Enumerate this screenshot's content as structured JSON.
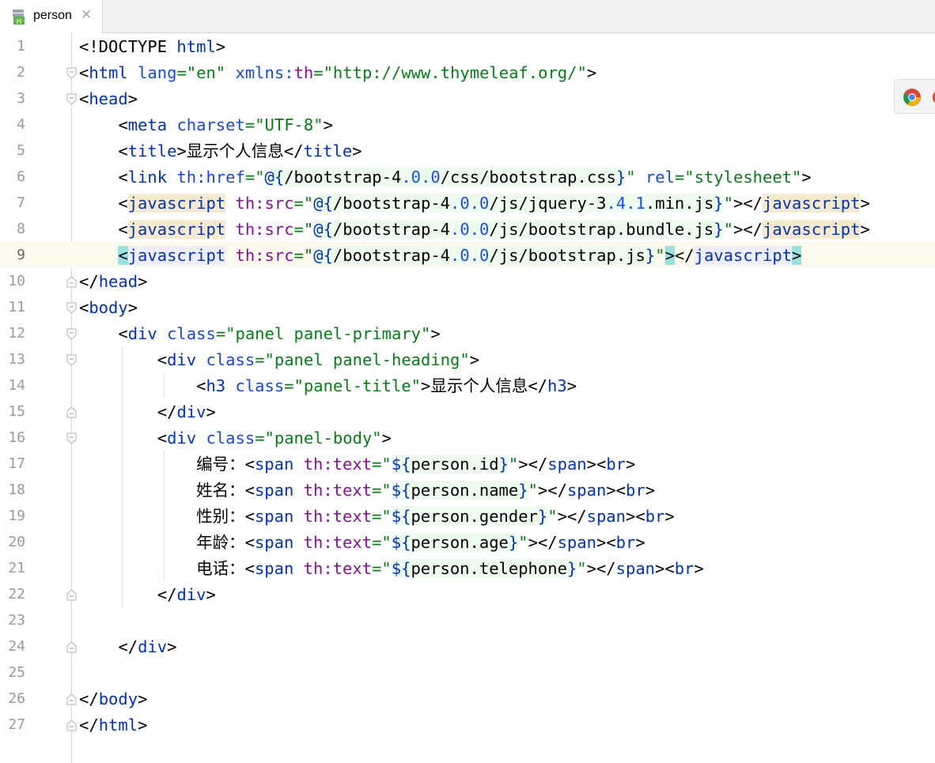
{
  "tab": {
    "label": "person",
    "close_glyph": "×",
    "icon": "html-file-icon"
  },
  "browser_popup": {
    "icons": [
      "chrome-icon",
      "browser-icon"
    ]
  },
  "line_numbers": [
    "1",
    "2",
    "3",
    "4",
    "5",
    "6",
    "7",
    "8",
    "9",
    "10",
    "11",
    "12",
    "13",
    "14",
    "15",
    "16",
    "17",
    "18",
    "19",
    "20",
    "21",
    "22",
    "23",
    "24",
    "25",
    "26",
    "27"
  ],
  "code": {
    "l1": {
      "doctype": "<!DOCTYPE ",
      "html": "html",
      "close": ">"
    },
    "l2": {
      "lt": "<",
      "tag": "html",
      "sp1": " ",
      "attr1": "lang",
      "eq1": "=",
      "val1": "\"en\"",
      "sp2": " ",
      "attr2": "xmlns:",
      "ns": "th",
      "eq2": "=",
      "val2": "\"http://www.thymeleaf.org/\"",
      "gt": ">"
    },
    "l3": {
      "lt": "<",
      "tag": "head",
      "gt": ">"
    },
    "l4": {
      "indent": "    ",
      "lt": "<",
      "tag": "meta",
      "sp": " ",
      "attr": "charset",
      "eq": "=",
      "val": "\"UTF-8\"",
      "gt": ">"
    },
    "l5": {
      "indent": "    ",
      "lt": "<",
      "tag": "title",
      "gt": ">",
      "text": "显示个人信息",
      "close_lt": "</",
      "close_tag": "title",
      "close_gt": ">"
    },
    "l6": {
      "indent": "    ",
      "lt": "<",
      "tag": "link",
      "sp": " ",
      "attr": "th:href",
      "eq": "=",
      "q1": "\"",
      "at": "@{",
      "p1": "/bootstrap-4",
      "n1": ".0.0",
      "p2": "/css/bootstrap.css",
      "endb": "}",
      "q2": "\"",
      "sp2": " ",
      "attr2": "rel",
      "eq2": "=",
      "val2": "\"stylesheet\"",
      "gt": ">"
    },
    "l7": {
      "indent": "    ",
      "lt": "<",
      "tag": "javascript",
      "sp": " ",
      "attr": "th:src",
      "eq": "=",
      "q1": "\"",
      "at": "@{",
      "p1": "/bootstrap-4",
      "n1": ".0.0",
      "p2": "/js/jquery-3",
      "n2": ".4.1",
      "p3": ".min.js",
      "endb": "}",
      "q2": "\"",
      "gt": ">",
      "close_lt": "</",
      "close_tag": "javascript",
      "close_gt": ">"
    },
    "l8": {
      "indent": "    ",
      "lt": "<",
      "tag": "javascript",
      "sp": " ",
      "attr": "th:src",
      "eq": "=",
      "q1": "\"",
      "at": "@{",
      "p1": "/bootstrap-4",
      "n1": ".0.0",
      "p2": "/js/bootstrap.bundle.js",
      "endb": "}",
      "q2": "\"",
      "gt": ">",
      "close_lt": "</",
      "close_tag": "javascript",
      "close_gt": ">"
    },
    "l9": {
      "indent": "    ",
      "lt": "<",
      "tag": "javascript",
      "sp": " ",
      "attr": "th:src",
      "eq": "=",
      "q1": "\"",
      "at": "@{",
      "p1": "/bootstrap-4",
      "n1": ".0.0",
      "p2": "/js/bootstrap.js",
      "endb": "}",
      "q2": "\"",
      "gt": ">",
      "close_lt": "</",
      "close_tag": "javascript",
      "close_gt": ">"
    },
    "l10": {
      "lt": "</",
      "tag": "head",
      "gt": ">"
    },
    "l11": {
      "lt": "<",
      "tag": "body",
      "gt": ">"
    },
    "l12": {
      "indent": "    ",
      "lt": "<",
      "tag": "div",
      "sp": " ",
      "attr": "class",
      "eq": "=",
      "val": "\"panel panel-primary\"",
      "gt": ">"
    },
    "l13": {
      "indent": "        ",
      "lt": "<",
      "tag": "div",
      "sp": " ",
      "attr": "class",
      "eq": "=",
      "val": "\"panel panel-heading\"",
      "gt": ">"
    },
    "l14": {
      "indent": "            ",
      "lt": "<",
      "tag": "h3",
      "sp": " ",
      "attr": "class",
      "eq": "=",
      "val": "\"panel-title\"",
      "gt": ">",
      "text": "显示个人信息",
      "close_lt": "</",
      "close_tag": "h3",
      "close_gt": ">"
    },
    "l15": {
      "indent": "        ",
      "lt": "</",
      "tag": "div",
      "gt": ">"
    },
    "l16": {
      "indent": "        ",
      "lt": "<",
      "tag": "div",
      "sp": " ",
      "attr": "class",
      "eq": "=",
      "val": "\"panel-body\"",
      "gt": ">"
    },
    "l17": {
      "indent": "            ",
      "label": "编号：",
      "lt": "<",
      "tag": "span",
      "sp": " ",
      "attr": "th:text",
      "eq": "=",
      "q1": "\"",
      "expr_open": "${",
      "expr": "person.id",
      "expr_close": "}",
      "q2": "\"",
      "gt": ">",
      "close_lt": "</",
      "close_tag": "span",
      "close_gt": ">",
      "br_lt": "<",
      "br": "br",
      "br_gt": ">"
    },
    "l18": {
      "indent": "            ",
      "label": "姓名：",
      "lt": "<",
      "tag": "span",
      "sp": " ",
      "attr": "th:text",
      "eq": "=",
      "q1": "\"",
      "expr_open": "${",
      "expr": "person.name",
      "expr_close": "}",
      "q2": "\"",
      "gt": ">",
      "close_lt": "</",
      "close_tag": "span",
      "close_gt": ">",
      "br_lt": "<",
      "br": "br",
      "br_gt": ">"
    },
    "l19": {
      "indent": "            ",
      "label": "性别：",
      "lt": "<",
      "tag": "span",
      "sp": " ",
      "attr": "th:text",
      "eq": "=",
      "q1": "\"",
      "expr_open": "${",
      "expr": "person.gender",
      "expr_close": "}",
      "q2": "\"",
      "gt": ">",
      "close_lt": "</",
      "close_tag": "span",
      "close_gt": ">",
      "br_lt": "<",
      "br": "br",
      "br_gt": ">"
    },
    "l20": {
      "indent": "            ",
      "label": "年龄：",
      "lt": "<",
      "tag": "span",
      "sp": " ",
      "attr": "th:text",
      "eq": "=",
      "q1": "\"",
      "expr_open": "${",
      "expr": "person.age",
      "expr_close": "}",
      "q2": "\"",
      "gt": ">",
      "close_lt": "</",
      "close_tag": "span",
      "close_gt": ">",
      "br_lt": "<",
      "br": "br",
      "br_gt": ">"
    },
    "l21": {
      "indent": "            ",
      "label": "电话：",
      "lt": "<",
      "tag": "span",
      "sp": " ",
      "attr": "th:text",
      "eq": "=",
      "q1": "\"",
      "expr_open": "${",
      "expr": "person.telephone",
      "expr_close": "}",
      "q2": "\"",
      "gt": ">",
      "close_lt": "</",
      "close_tag": "span",
      "close_gt": ">",
      "br_lt": "<",
      "br": "br",
      "br_gt": ">"
    },
    "l22": {
      "indent": "        ",
      "lt": "</",
      "tag": "div",
      "gt": ">"
    },
    "l24": {
      "indent": "    ",
      "lt": "</",
      "tag": "div",
      "gt": ">"
    },
    "l26": {
      "lt": "</",
      "tag": "body",
      "gt": ">"
    },
    "l27": {
      "lt": "</",
      "tag": "html",
      "gt": ">"
    }
  },
  "colors": {
    "tag": "#0033b3",
    "attr": "#174ad4",
    "string": "#067d17",
    "namespace": "#871094",
    "current_line": "#fcfaed",
    "match_highlight": "#f5eacd",
    "bracket_highlight": "#99e2e2"
  }
}
